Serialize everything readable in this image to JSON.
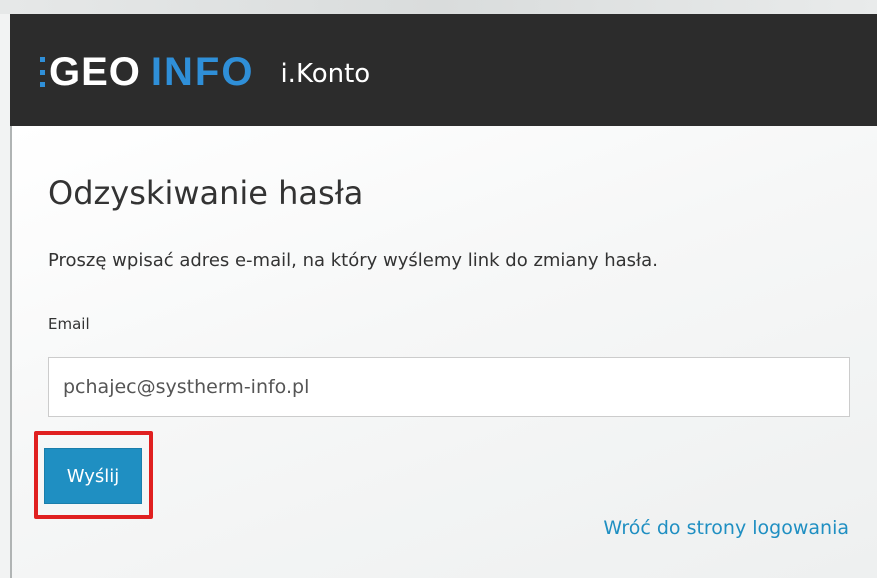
{
  "header": {
    "logo_geo": "GEO",
    "logo_info": "INFO",
    "app_name": "i.Konto"
  },
  "form": {
    "title": "Odzyskiwanie hasła",
    "description": "Proszę wpisać adres e-mail, na który wyślemy link do zmiany hasła.",
    "email_label": "Email",
    "email_value": "pchajec@systherm-info.pl",
    "submit_label": "Wyślij",
    "back_link": "Wróć do strony logowania"
  },
  "colors": {
    "header_bg": "#2c2c2c",
    "brand_blue": "#2f8fd8",
    "button_bg": "#1f8fc2",
    "highlight": "#e02020"
  }
}
